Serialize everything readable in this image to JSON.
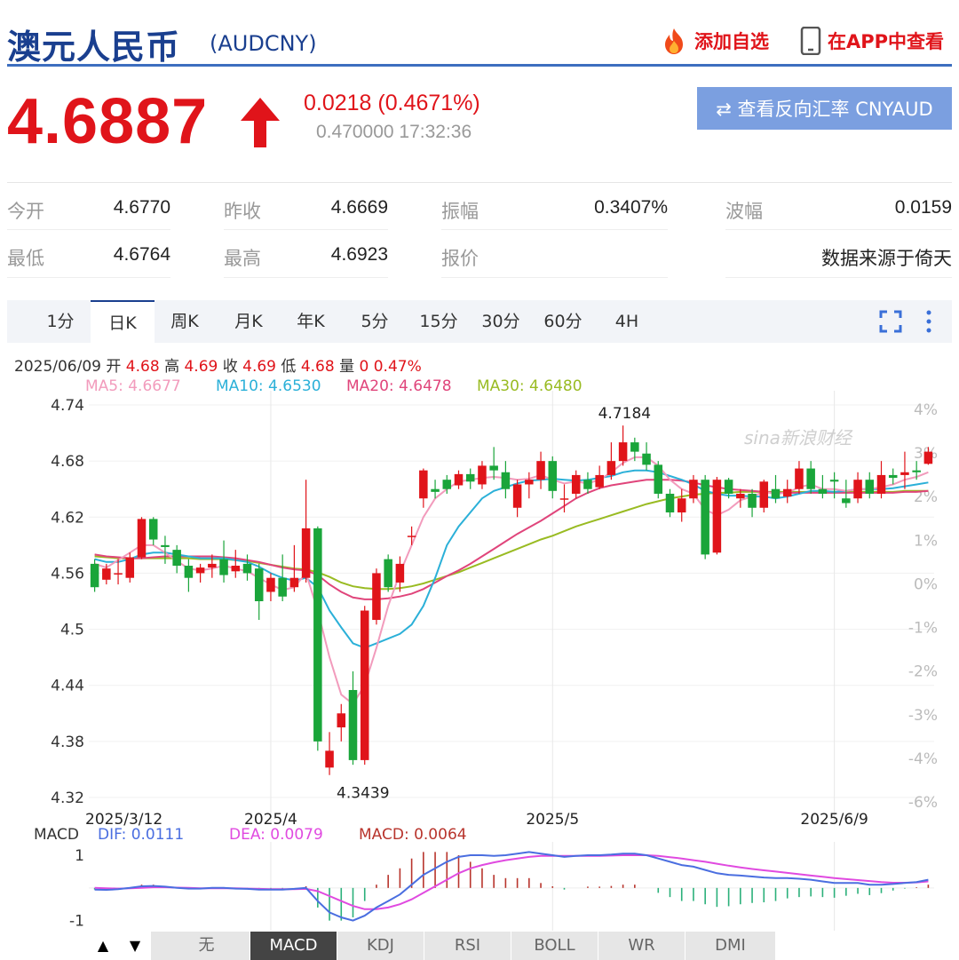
{
  "header": {
    "title": "澳元人民币",
    "code": "(AUDCNY)",
    "add_watch": "添加自选",
    "app_view": "在APP中查看"
  },
  "quote": {
    "price": "4.6887",
    "change": "0.0218 (0.4671%)",
    "sub": "0.470000 17:32:36",
    "reverse_button": "⇄ 查看反向汇率 CNYAUD"
  },
  "stats": [
    {
      "label": "今开",
      "value": "4.6770"
    },
    {
      "label": "昨收",
      "value": "4.6669"
    },
    {
      "label": "振幅",
      "value": "0.3407%"
    },
    {
      "label": "波幅",
      "value": "0.0159"
    },
    {
      "label": "最低",
      "value": "4.6764"
    },
    {
      "label": "最高",
      "value": "4.6923"
    },
    {
      "label": "报价",
      "value": ""
    },
    {
      "label": "",
      "value": "数据来源于倚天"
    }
  ],
  "tabs": [
    "1分",
    "日K",
    "周K",
    "月K",
    "年K",
    "5分",
    "15分",
    "30分",
    "60分",
    "4H"
  ],
  "active_tab": "日K",
  "info_line": {
    "date": "2025/06/09",
    "open_label": "开",
    "open": "4.68",
    "high_label": "高",
    "high": "4.69",
    "close_label": "收",
    "close": "4.69",
    "low_label": "低",
    "low": "4.68",
    "vol_label": "量",
    "vol": "0",
    "pct": "0.47%"
  },
  "ma_legend": [
    {
      "label": "MA5: 4.6677",
      "color": "#f29bbc"
    },
    {
      "label": "MA10: 4.6530",
      "color": "#2bb0d8"
    },
    {
      "label": "MA20: 4.6478",
      "color": "#e0457b"
    },
    {
      "label": "MA30: 4.6480",
      "color": "#99bb22"
    }
  ],
  "watermark": "sina新浪财经",
  "macd_legend": {
    "title": "MACD",
    "dif": "DIF: 0.0111",
    "dea": "DEA: 0.0079",
    "macd": "MACD: 0.0064"
  },
  "indicators": [
    "无",
    "MACD",
    "KDJ",
    "RSI",
    "BOLL",
    "WR",
    "DMI"
  ],
  "active_indicator": "MACD",
  "colors": {
    "up": "#e0141a",
    "down": "#1aa53a",
    "brand": "#1a3f8f",
    "dif": "#4a6ee0",
    "dea": "#e04ae0"
  },
  "chart_data": {
    "type": "candlestick",
    "y_ticks": [
      "4.74",
      "4.68",
      "4.62",
      "4.56",
      "4.5",
      "4.44",
      "4.38",
      "4.32"
    ],
    "ylim": [
      4.32,
      4.74
    ],
    "pct_ticks": [
      "4%",
      "3%",
      "2%",
      "1%",
      "0%",
      "-1%",
      "-2%",
      "-3%",
      "-4%",
      "-6%"
    ],
    "x_labels": [
      {
        "label": "2025/3/12",
        "index": 0
      },
      {
        "label": "2025/4",
        "index": 15
      },
      {
        "label": "2025/5",
        "index": 39
      },
      {
        "label": "2025/6/9",
        "index": 63
      }
    ],
    "max_label": "4.7184",
    "min_label": "4.3439",
    "candles": [
      [
        4.57,
        4.545,
        4.575,
        4.54
      ],
      [
        4.553,
        4.565,
        4.57,
        4.548
      ],
      [
        4.56,
        4.56,
        4.575,
        4.548
      ],
      [
        4.555,
        4.577,
        4.582,
        4.55
      ],
      [
        4.577,
        4.618,
        4.62,
        4.575
      ],
      [
        4.618,
        4.596,
        4.62,
        4.59
      ],
      [
        4.59,
        4.588,
        4.6,
        4.57
      ],
      [
        4.585,
        4.568,
        4.59,
        4.56
      ],
      [
        4.568,
        4.555,
        4.575,
        4.54
      ],
      [
        4.56,
        4.566,
        4.57,
        4.55
      ],
      [
        4.566,
        4.57,
        4.58,
        4.555
      ],
      [
        4.575,
        4.558,
        4.595,
        4.55
      ],
      [
        4.562,
        4.568,
        4.585,
        4.555
      ],
      [
        4.57,
        4.56,
        4.58,
        4.552
      ],
      [
        4.565,
        4.53,
        4.57,
        4.51
      ],
      [
        4.54,
        4.555,
        4.56,
        4.53
      ],
      [
        4.555,
        4.535,
        4.58,
        4.53
      ],
      [
        4.545,
        4.555,
        4.59,
        4.54
      ],
      [
        4.555,
        4.608,
        4.66,
        4.55
      ],
      [
        4.608,
        4.38,
        4.61,
        4.37
      ],
      [
        4.352,
        4.37,
        4.39,
        4.344
      ],
      [
        4.395,
        4.41,
        4.42,
        4.38
      ],
      [
        4.435,
        4.36,
        4.455,
        4.355
      ],
      [
        4.36,
        4.52,
        4.525,
        4.355
      ],
      [
        4.51,
        4.56,
        4.565,
        4.505
      ],
      [
        4.575,
        4.545,
        4.58,
        4.54
      ],
      [
        4.55,
        4.57,
        4.578,
        4.54
      ],
      [
        4.6,
        4.6,
        4.61,
        4.59
      ],
      [
        4.64,
        4.67,
        4.672,
        4.63
      ],
      [
        4.65,
        4.647,
        4.66,
        4.64
      ],
      [
        4.66,
        4.65,
        4.665,
        4.645
      ],
      [
        4.654,
        4.666,
        4.67,
        4.65
      ],
      [
        4.666,
        4.658,
        4.672,
        4.65
      ],
      [
        4.655,
        4.675,
        4.68,
        4.65
      ],
      [
        4.675,
        4.67,
        4.695,
        4.66
      ],
      [
        4.668,
        4.65,
        4.68,
        4.64
      ],
      [
        4.63,
        4.655,
        4.66,
        4.62
      ],
      [
        4.655,
        4.66,
        4.668,
        4.64
      ],
      [
        4.66,
        4.68,
        4.69,
        4.65
      ],
      [
        4.68,
        4.648,
        4.685,
        4.64
      ],
      [
        4.64,
        4.64,
        4.655,
        4.625
      ],
      [
        4.645,
        4.665,
        4.67,
        4.64
      ],
      [
        4.66,
        4.65,
        4.668,
        4.645
      ],
      [
        4.652,
        4.665,
        4.675,
        4.65
      ],
      [
        4.665,
        4.68,
        4.7,
        4.66
      ],
      [
        4.68,
        4.7,
        4.718,
        4.675
      ],
      [
        4.7,
        4.69,
        4.705,
        4.68
      ],
      [
        4.688,
        4.676,
        4.7,
        4.67
      ],
      [
        4.676,
        4.645,
        4.68,
        4.64
      ],
      [
        4.645,
        4.625,
        4.65,
        4.62
      ],
      [
        4.625,
        4.64,
        4.65,
        4.615
      ],
      [
        4.64,
        4.66,
        4.665,
        4.635
      ],
      [
        4.66,
        4.58,
        4.665,
        4.575
      ],
      [
        4.582,
        4.66,
        4.663,
        4.58
      ],
      [
        4.66,
        4.645,
        4.662,
        4.64
      ],
      [
        4.64,
        4.645,
        4.65,
        4.63
      ],
      [
        4.645,
        4.63,
        4.65,
        4.62
      ],
      [
        4.63,
        4.658,
        4.66,
        4.625
      ],
      [
        4.65,
        4.64,
        4.665,
        4.635
      ],
      [
        4.642,
        4.65,
        4.66,
        4.635
      ],
      [
        4.65,
        4.672,
        4.68,
        4.645
      ],
      [
        4.672,
        4.65,
        4.68,
        4.645
      ],
      [
        4.65,
        4.645,
        4.665,
        4.64
      ],
      [
        4.66,
        4.658,
        4.668,
        4.64
      ],
      [
        4.64,
        4.635,
        4.66,
        4.63
      ],
      [
        4.64,
        4.66,
        4.668,
        4.635
      ],
      [
        4.66,
        4.645,
        4.668,
        4.64
      ],
      [
        4.645,
        4.665,
        4.68,
        4.64
      ],
      [
        4.665,
        4.662,
        4.672,
        4.655
      ],
      [
        4.665,
        4.668,
        4.69,
        4.65
      ],
      [
        4.67,
        4.668,
        4.68,
        4.66
      ],
      [
        4.677,
        4.69,
        4.695,
        4.676
      ]
    ],
    "ma5": [
      4.57,
      4.566,
      4.574,
      4.582,
      4.59,
      4.59,
      4.582,
      4.573,
      4.565,
      4.563,
      4.565,
      4.568,
      4.565,
      4.562,
      4.555,
      4.548,
      4.542,
      4.545,
      4.56,
      4.52,
      4.47,
      4.43,
      4.42,
      4.44,
      4.48,
      4.525,
      4.56,
      4.59,
      4.62,
      4.64,
      4.65,
      4.658,
      4.66,
      4.662,
      4.663,
      4.662,
      4.66,
      4.661,
      4.665,
      4.66,
      4.656,
      4.658,
      4.656,
      4.66,
      4.668,
      4.678,
      4.684,
      4.684,
      4.675,
      4.66,
      4.65,
      4.645,
      4.628,
      4.622,
      4.628,
      4.638,
      4.642,
      4.647,
      4.645,
      4.646,
      4.652,
      4.655,
      4.65,
      4.65,
      4.648,
      4.65,
      4.65,
      4.652,
      4.655,
      4.66,
      4.663,
      4.668
    ],
    "ma10": [
      4.575,
      4.572,
      4.572,
      4.575,
      4.58,
      4.582,
      4.582,
      4.58,
      4.578,
      4.576,
      4.576,
      4.576,
      4.574,
      4.572,
      4.567,
      4.56,
      4.555,
      4.552,
      4.555,
      4.545,
      4.52,
      4.502,
      4.485,
      4.48,
      4.485,
      4.49,
      4.495,
      4.505,
      4.525,
      4.555,
      4.59,
      4.61,
      4.625,
      4.64,
      4.648,
      4.652,
      4.656,
      4.659,
      4.66,
      4.661,
      4.66,
      4.659,
      4.66,
      4.662,
      4.664,
      4.668,
      4.67,
      4.67,
      4.668,
      4.664,
      4.66,
      4.655,
      4.648,
      4.645,
      4.643,
      4.643,
      4.642,
      4.642,
      4.64,
      4.642,
      4.645,
      4.648,
      4.648,
      4.647,
      4.648,
      4.65,
      4.65,
      4.65,
      4.651,
      4.653,
      4.655,
      4.657
    ],
    "ma20": [
      4.58,
      4.578,
      4.577,
      4.576,
      4.576,
      4.577,
      4.578,
      4.578,
      4.578,
      4.578,
      4.578,
      4.577,
      4.576,
      4.574,
      4.572,
      4.569,
      4.566,
      4.564,
      4.563,
      4.558,
      4.548,
      4.54,
      4.534,
      4.532,
      4.532,
      4.533,
      4.535,
      4.538,
      4.543,
      4.55,
      4.557,
      4.563,
      4.57,
      4.578,
      4.586,
      4.594,
      4.602,
      4.609,
      4.616,
      4.624,
      4.632,
      4.64,
      4.646,
      4.651,
      4.654,
      4.656,
      4.658,
      4.66,
      4.66,
      4.66,
      4.659,
      4.657,
      4.654,
      4.652,
      4.65,
      4.649,
      4.648,
      4.647,
      4.646,
      4.646,
      4.646,
      4.646,
      4.646,
      4.646,
      4.646,
      4.646,
      4.646,
      4.646,
      4.646,
      4.647,
      4.647,
      4.648
    ],
    "ma30": [
      4.578,
      4.577,
      4.576,
      4.576,
      4.576,
      4.576,
      4.576,
      4.576,
      4.576,
      4.575,
      4.575,
      4.575,
      4.574,
      4.573,
      4.571,
      4.569,
      4.567,
      4.565,
      4.564,
      4.561,
      4.556,
      4.55,
      4.546,
      4.544,
      4.543,
      4.543,
      4.544,
      4.546,
      4.549,
      4.553,
      4.557,
      4.561,
      4.566,
      4.571,
      4.576,
      4.581,
      4.586,
      4.591,
      4.596,
      4.6,
      4.605,
      4.61,
      4.614,
      4.618,
      4.622,
      4.626,
      4.63,
      4.634,
      4.637,
      4.64,
      4.642,
      4.644,
      4.645,
      4.646,
      4.646,
      4.647,
      4.647,
      4.647,
      4.647,
      4.647,
      4.647,
      4.647,
      4.647,
      4.647,
      4.647,
      4.647,
      4.647,
      4.647,
      4.647,
      4.648,
      4.648,
      4.648
    ],
    "macd_ylim": [
      -1.2,
      1.3
    ],
    "macd_ticks": [
      "1",
      "-1"
    ],
    "dif": [
      -0.05,
      -0.06,
      -0.04,
      0.0,
      0.05,
      0.06,
      0.04,
      0.0,
      -0.02,
      -0.02,
      0.0,
      0.0,
      -0.02,
      -0.03,
      -0.05,
      -0.05,
      -0.05,
      -0.03,
      0.0,
      -0.4,
      -0.75,
      -0.9,
      -1.0,
      -0.85,
      -0.6,
      -0.4,
      -0.2,
      0.1,
      0.4,
      0.6,
      0.8,
      0.95,
      1.0,
      1.0,
      0.98,
      1.0,
      1.05,
      1.1,
      1.05,
      1.0,
      0.95,
      0.98,
      1.0,
      1.0,
      1.02,
      1.05,
      1.05,
      1.0,
      0.9,
      0.8,
      0.7,
      0.65,
      0.55,
      0.45,
      0.4,
      0.38,
      0.35,
      0.32,
      0.3,
      0.3,
      0.28,
      0.25,
      0.2,
      0.15,
      0.15,
      0.15,
      0.1,
      0.1,
      0.12,
      0.15,
      0.18,
      0.25
    ],
    "dea": [
      0.0,
      -0.01,
      -0.02,
      -0.01,
      0.0,
      0.02,
      0.02,
      0.01,
      0.0,
      -0.01,
      -0.01,
      -0.01,
      -0.01,
      -0.02,
      -0.03,
      -0.04,
      -0.04,
      -0.04,
      -0.03,
      -0.1,
      -0.25,
      -0.4,
      -0.55,
      -0.65,
      -0.65,
      -0.6,
      -0.5,
      -0.35,
      -0.15,
      0.05,
      0.25,
      0.45,
      0.6,
      0.7,
      0.78,
      0.85,
      0.9,
      0.95,
      0.98,
      0.98,
      0.98,
      0.98,
      0.98,
      0.98,
      0.99,
      1.0,
      1.0,
      1.0,
      0.98,
      0.94,
      0.9,
      0.85,
      0.8,
      0.74,
      0.68,
      0.63,
      0.58,
      0.54,
      0.5,
      0.46,
      0.42,
      0.38,
      0.34,
      0.3,
      0.27,
      0.24,
      0.21,
      0.18,
      0.16,
      0.16,
      0.17,
      0.2
    ],
    "macd": [
      -0.05,
      -0.08,
      -0.05,
      0.02,
      0.1,
      0.1,
      0.05,
      0.0,
      -0.03,
      -0.03,
      0.0,
      0.0,
      -0.03,
      -0.03,
      -0.06,
      -0.05,
      -0.05,
      0.0,
      0.05,
      -0.6,
      -1.0,
      -1.0,
      -0.9,
      -0.4,
      0.1,
      0.4,
      0.6,
      0.9,
      1.1,
      1.1,
      1.1,
      1.0,
      0.8,
      0.6,
      0.4,
      0.3,
      0.3,
      0.3,
      0.15,
      0.05,
      -0.05,
      0.0,
      0.04,
      0.04,
      0.06,
      0.1,
      0.1,
      0.0,
      -0.15,
      -0.28,
      -0.4,
      -0.4,
      -0.5,
      -0.58,
      -0.56,
      -0.5,
      -0.46,
      -0.44,
      -0.4,
      -0.32,
      -0.28,
      -0.26,
      -0.28,
      -0.3,
      -0.24,
      -0.18,
      -0.22,
      -0.16,
      -0.08,
      -0.02,
      0.02,
      0.1
    ]
  }
}
